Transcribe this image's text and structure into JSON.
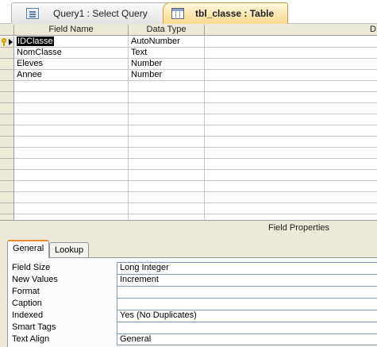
{
  "tabs": [
    {
      "label": "Query1 : Select Query",
      "icon": "query-icon",
      "active": false
    },
    {
      "label": "tbl_classe : Table",
      "icon": "table-icon",
      "active": true
    }
  ],
  "grid": {
    "headers": {
      "field_name": "Field Name",
      "data_type": "Data Type",
      "description": "D"
    },
    "rows": [
      {
        "field_name": "IDClasse",
        "data_type": "AutoNumber",
        "primary_key": true,
        "current": true
      },
      {
        "field_name": "NomClasse",
        "data_type": "Text"
      },
      {
        "field_name": "Eleves",
        "data_type": "Number"
      },
      {
        "field_name": "Annee",
        "data_type": "Number"
      }
    ],
    "empty_rows": 13
  },
  "field_properties": {
    "title": "Field Properties",
    "tabs": {
      "general": "General",
      "lookup": "Lookup"
    },
    "properties": [
      {
        "label": "Field Size",
        "value": "Long Integer"
      },
      {
        "label": "New Values",
        "value": "Increment"
      },
      {
        "label": "Format",
        "value": ""
      },
      {
        "label": "Caption",
        "value": ""
      },
      {
        "label": "Indexed",
        "value": "Yes (No Duplicates)"
      },
      {
        "label": "Smart Tags",
        "value": ""
      },
      {
        "label": "Text Align",
        "value": "General"
      }
    ]
  }
}
